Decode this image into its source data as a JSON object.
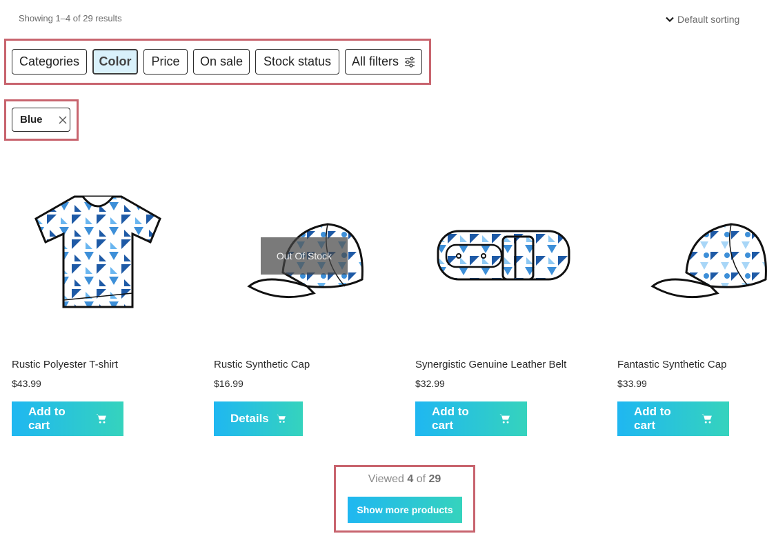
{
  "results": {
    "text": "Showing 1–4 of 29 results"
  },
  "sorting": {
    "label": "Default sorting",
    "icon": "chevron-down-icon"
  },
  "filters": {
    "chips": [
      {
        "label": "Categories",
        "active": false
      },
      {
        "label": "Color",
        "active": true
      },
      {
        "label": "Price",
        "active": false
      },
      {
        "label": "On sale",
        "active": false
      },
      {
        "label": "Stock status",
        "active": false
      },
      {
        "label": "All filters",
        "active": false,
        "icon": "sliders-icon"
      }
    ]
  },
  "active_filters": [
    {
      "label": "Blue",
      "icon": "close-icon"
    }
  ],
  "products": [
    {
      "title": "Rustic Polyester T-shirt",
      "price": "$43.99",
      "button": "Add to cart",
      "badge": "",
      "image": "tshirt"
    },
    {
      "title": "Rustic Synthetic Cap",
      "price": "$16.99",
      "button": "Details",
      "badge": "Out Of Stock",
      "image": "cap"
    },
    {
      "title": "Synergistic Genuine Leather Belt",
      "price": "$32.99",
      "button": "Add to cart",
      "badge": "",
      "image": "belt"
    },
    {
      "title": "Fantastic Synthetic Cap",
      "price": "$33.99",
      "button": "Add to cart",
      "badge": "",
      "image": "cap"
    }
  ],
  "pagination": {
    "viewed_prefix": "Viewed",
    "viewed_count": "4",
    "viewed_of": "of",
    "viewed_total": "29",
    "more_label": "Show more products"
  },
  "colors": {
    "accent_start": "#1fb7f1",
    "accent_end": "#35d3bd",
    "highlight": "#c8646e",
    "active_chip": "#d9f1fb"
  }
}
